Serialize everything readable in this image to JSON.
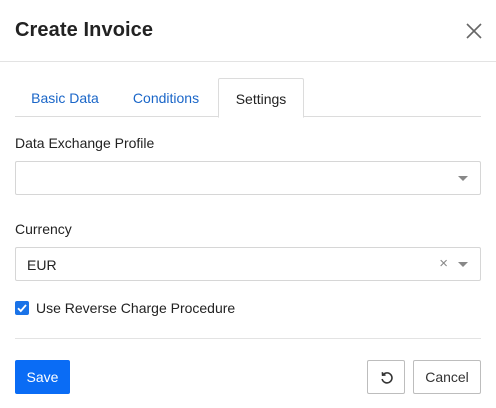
{
  "dialog": {
    "title": "Create Invoice",
    "close_icon": "close-icon"
  },
  "tabs": [
    {
      "label": "Basic Data",
      "active": false
    },
    {
      "label": "Conditions",
      "active": false
    },
    {
      "label": "Settings",
      "active": true
    }
  ],
  "form": {
    "data_exchange_profile": {
      "label": "Data Exchange Profile",
      "value": "",
      "icon": "chevron-down-icon"
    },
    "currency": {
      "label": "Currency",
      "value": "EUR",
      "clear_glyph": "×",
      "icon": "chevron-down-icon"
    },
    "reverse_charge": {
      "label": "Use Reverse Charge Procedure",
      "checked": true
    }
  },
  "footer": {
    "save_label": "Save",
    "reset_icon": "reset-icon",
    "cancel_label": "Cancel"
  },
  "colors": {
    "primary": "#0a6cf5",
    "link": "#1a66c8",
    "border": "#d6d6d6"
  }
}
